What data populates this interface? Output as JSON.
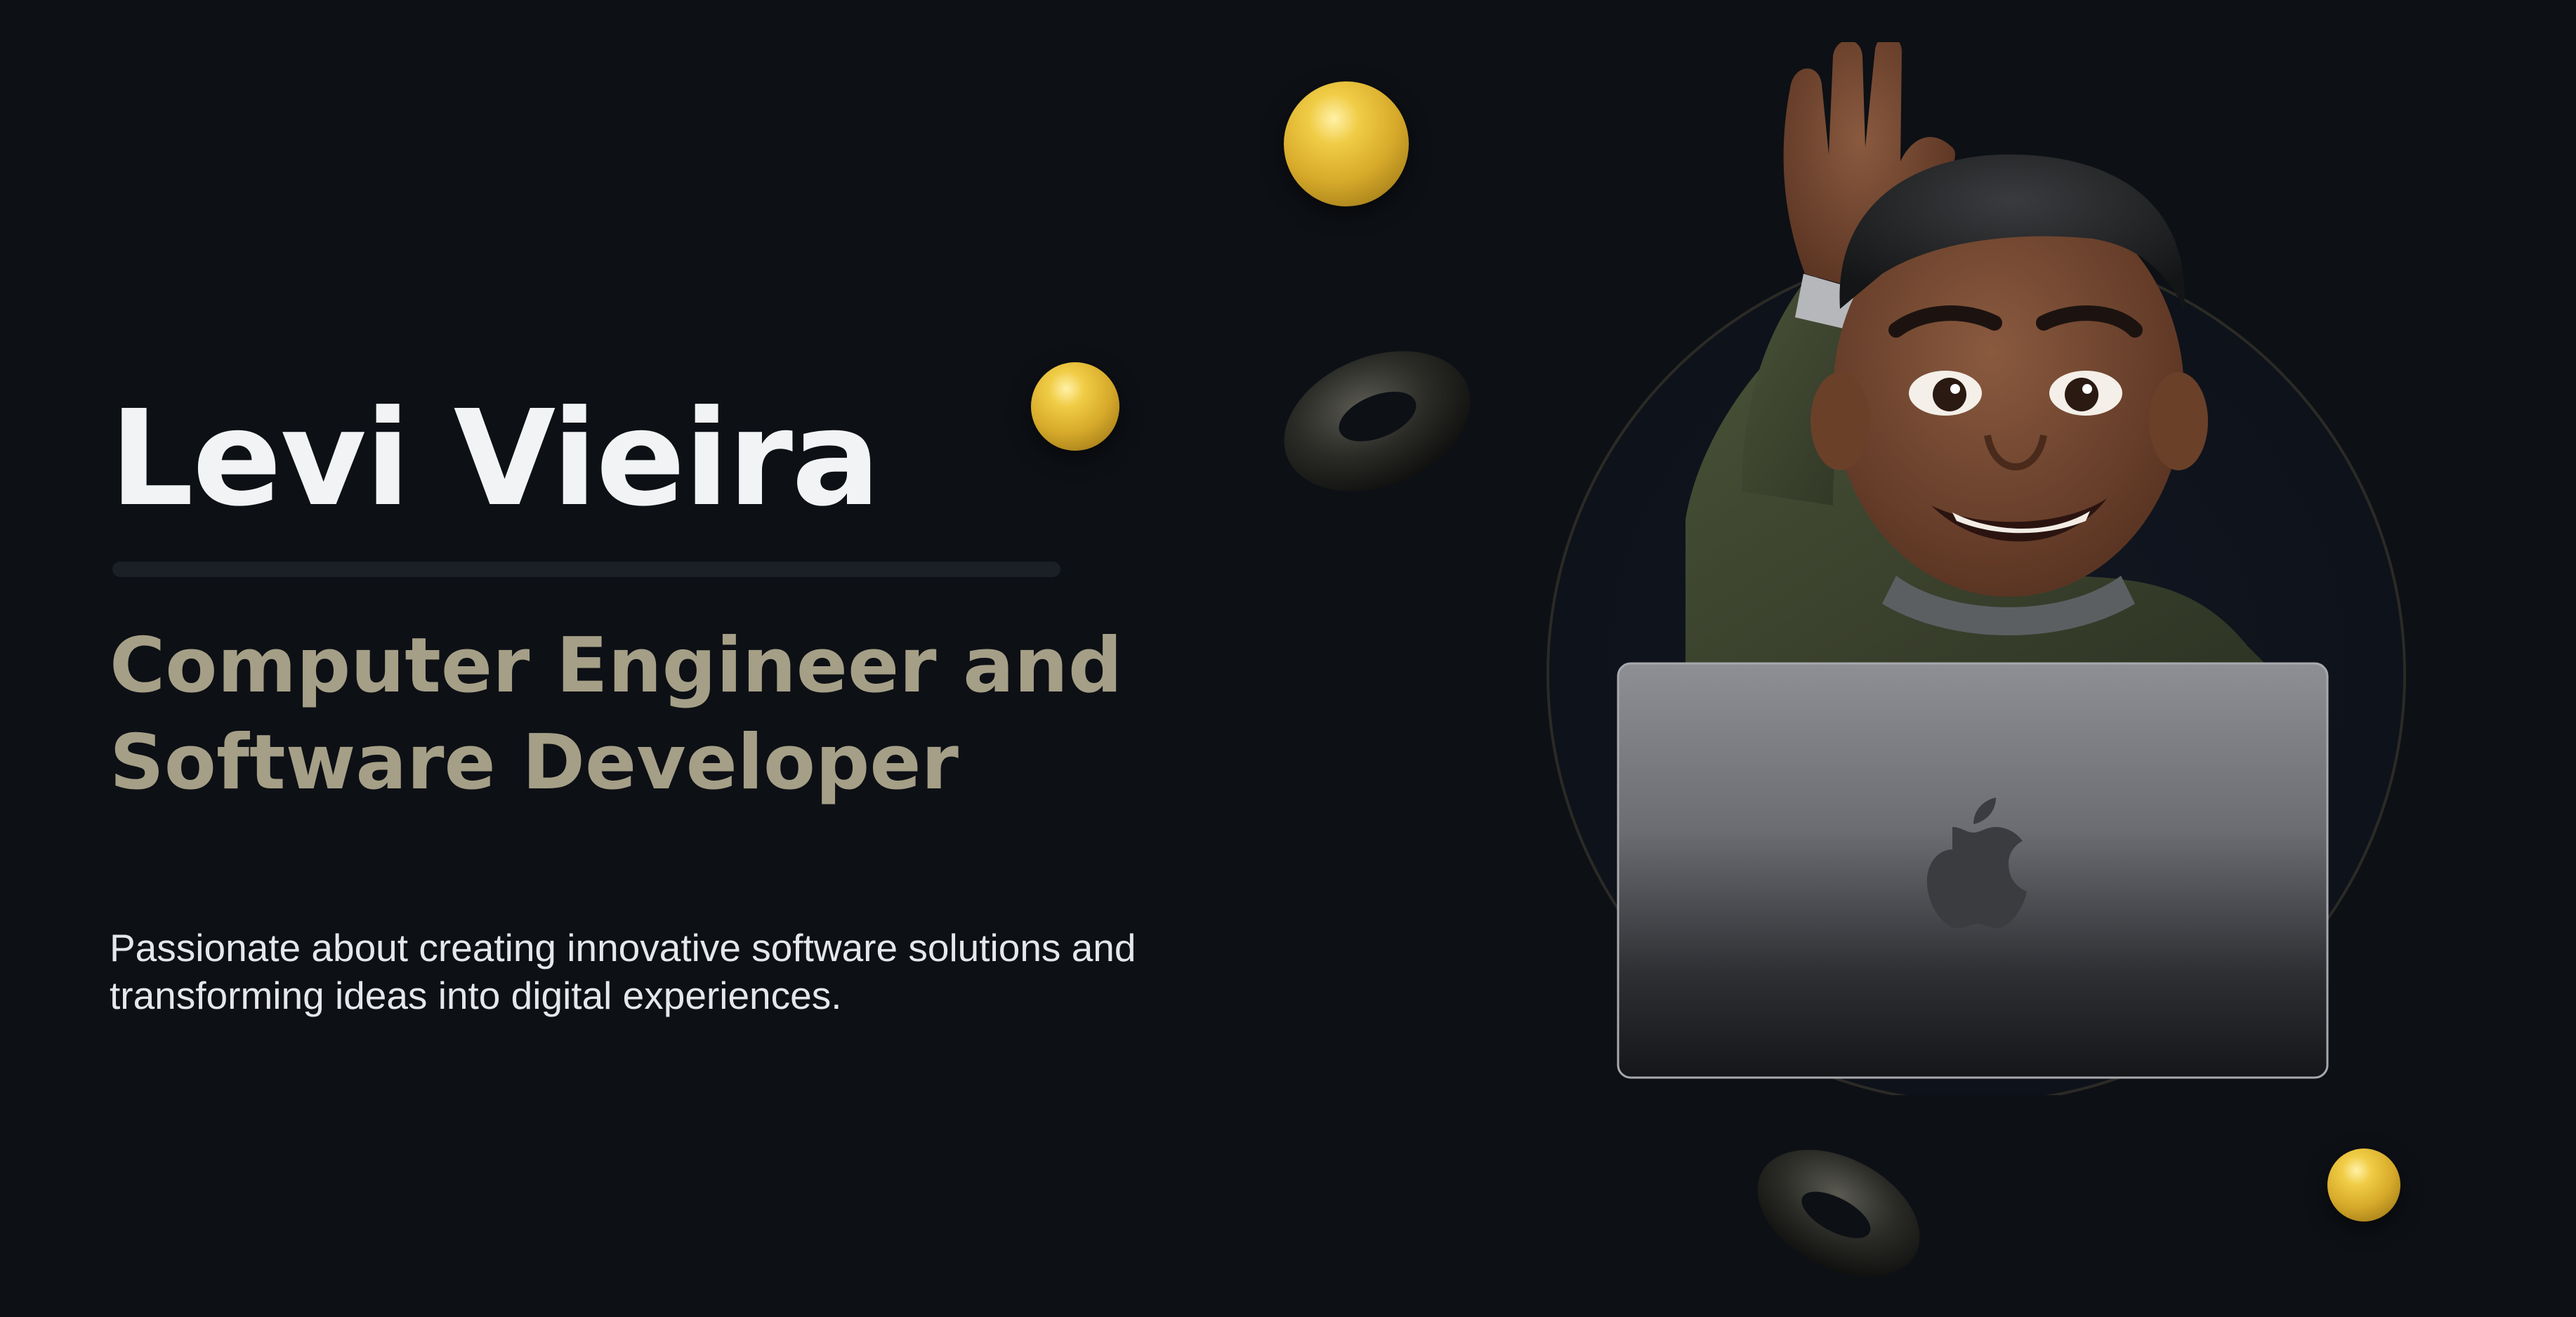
{
  "hero": {
    "name": "Levi Vieira",
    "title_lines": [
      "Computer Engineer and",
      "Software Developer"
    ],
    "tagline_lines": [
      "Passionate about creating innovative software solutions and",
      "transforming ideas into digital experiences."
    ]
  },
  "colors": {
    "background": "#0d1015",
    "name": "#f2f3f5",
    "title": "#a59f87",
    "tagline": "#e6e7ea",
    "accent_gold": "#e8bf3a"
  },
  "illustration": {
    "avatar": "memoji-waving-with-laptop",
    "laptop_logo": "apple-logo-icon",
    "decorations": [
      "gold-sphere",
      "gold-sphere",
      "dark-torus",
      "dark-torus",
      "gold-sphere"
    ]
  }
}
